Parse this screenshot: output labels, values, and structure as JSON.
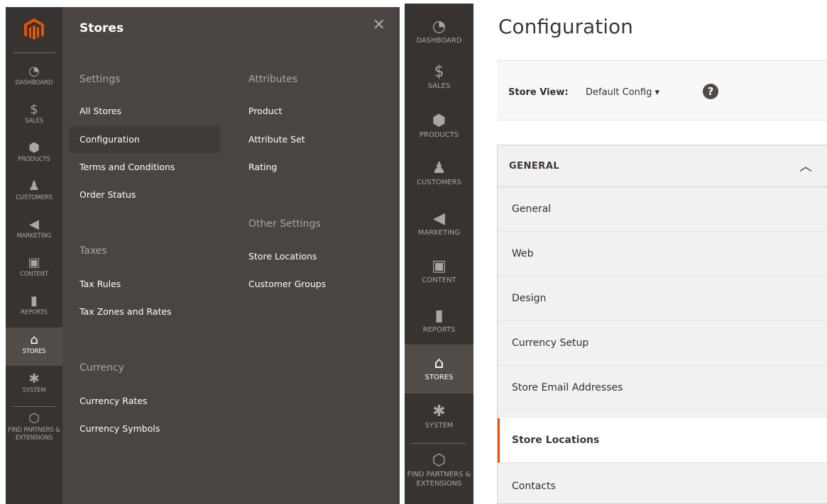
{
  "left_panel": {
    "nav": [
      {
        "label": "DASHBOARD",
        "icon": "dashboard-icon",
        "glyph": "◔"
      },
      {
        "label": "SALES",
        "icon": "dollar-icon",
        "glyph": "$"
      },
      {
        "label": "PRODUCTS",
        "icon": "cube-icon",
        "glyph": "⬢"
      },
      {
        "label": "CUSTOMERS",
        "icon": "person-icon",
        "glyph": "♟"
      },
      {
        "label": "MARKETING",
        "icon": "megaphone-icon",
        "glyph": "◀"
      },
      {
        "label": "CONTENT",
        "icon": "layout-icon",
        "glyph": "▣"
      },
      {
        "label": "REPORTS",
        "icon": "bar-chart-icon",
        "glyph": "▮"
      },
      {
        "label": "STORES",
        "icon": "storefront-icon",
        "glyph": "⌂"
      },
      {
        "label": "SYSTEM",
        "icon": "gear-icon",
        "glyph": "✱"
      },
      {
        "label": "FIND PARTNERS & EXTENSIONS",
        "icon": "cubes-icon",
        "glyph": "⬡"
      }
    ],
    "submenu": {
      "title": "Stores",
      "close_glyph": "✕",
      "settings_heading": "Settings",
      "settings": [
        "All Stores",
        "Configuration",
        "Terms and Conditions",
        "Order Status"
      ],
      "taxes_heading": "Taxes",
      "taxes": [
        "Tax Rules",
        "Tax Zones and Rates"
      ],
      "currency_heading": "Currency",
      "currency": [
        "Currency Rates",
        "Currency Symbols"
      ],
      "attributes_heading": "Attributes",
      "attributes": [
        "Product",
        "Attribute Set",
        "Rating"
      ],
      "other_heading": "Other Settings",
      "other": [
        "Store Locations",
        "Customer Groups"
      ]
    }
  },
  "right_panel": {
    "nav": [
      {
        "label": "DASHBOARD",
        "glyph": "◔"
      },
      {
        "label": "SALES",
        "glyph": "$"
      },
      {
        "label": "PRODUCTS",
        "glyph": "⬢"
      },
      {
        "label": "CUSTOMERS",
        "glyph": "♟"
      },
      {
        "label": "MARKETING",
        "glyph": "◀"
      },
      {
        "label": "CONTENT",
        "glyph": "▣"
      },
      {
        "label": "REPORTS",
        "glyph": "▮"
      },
      {
        "label": "STORES",
        "glyph": "⌂"
      },
      {
        "label": "SYSTEM",
        "glyph": "✱"
      },
      {
        "label": "FIND PARTNERS & EXTENSIONS",
        "glyph": "⬡"
      }
    ],
    "page_title": "Configuration",
    "scope": {
      "label": "Store View:",
      "value": "Default Config ▾",
      "help_glyph": "?"
    },
    "tabs": {
      "heading": "GENERAL",
      "chevron": "︿",
      "items": [
        "General",
        "Web",
        "Design",
        "Currency Setup",
        "Store Email Addresses",
        "Store Locations",
        "Contacts"
      ]
    }
  },
  "colors": {
    "accent": "#eb5202",
    "sidebar": "#373330",
    "submenu": "#4a4542"
  }
}
